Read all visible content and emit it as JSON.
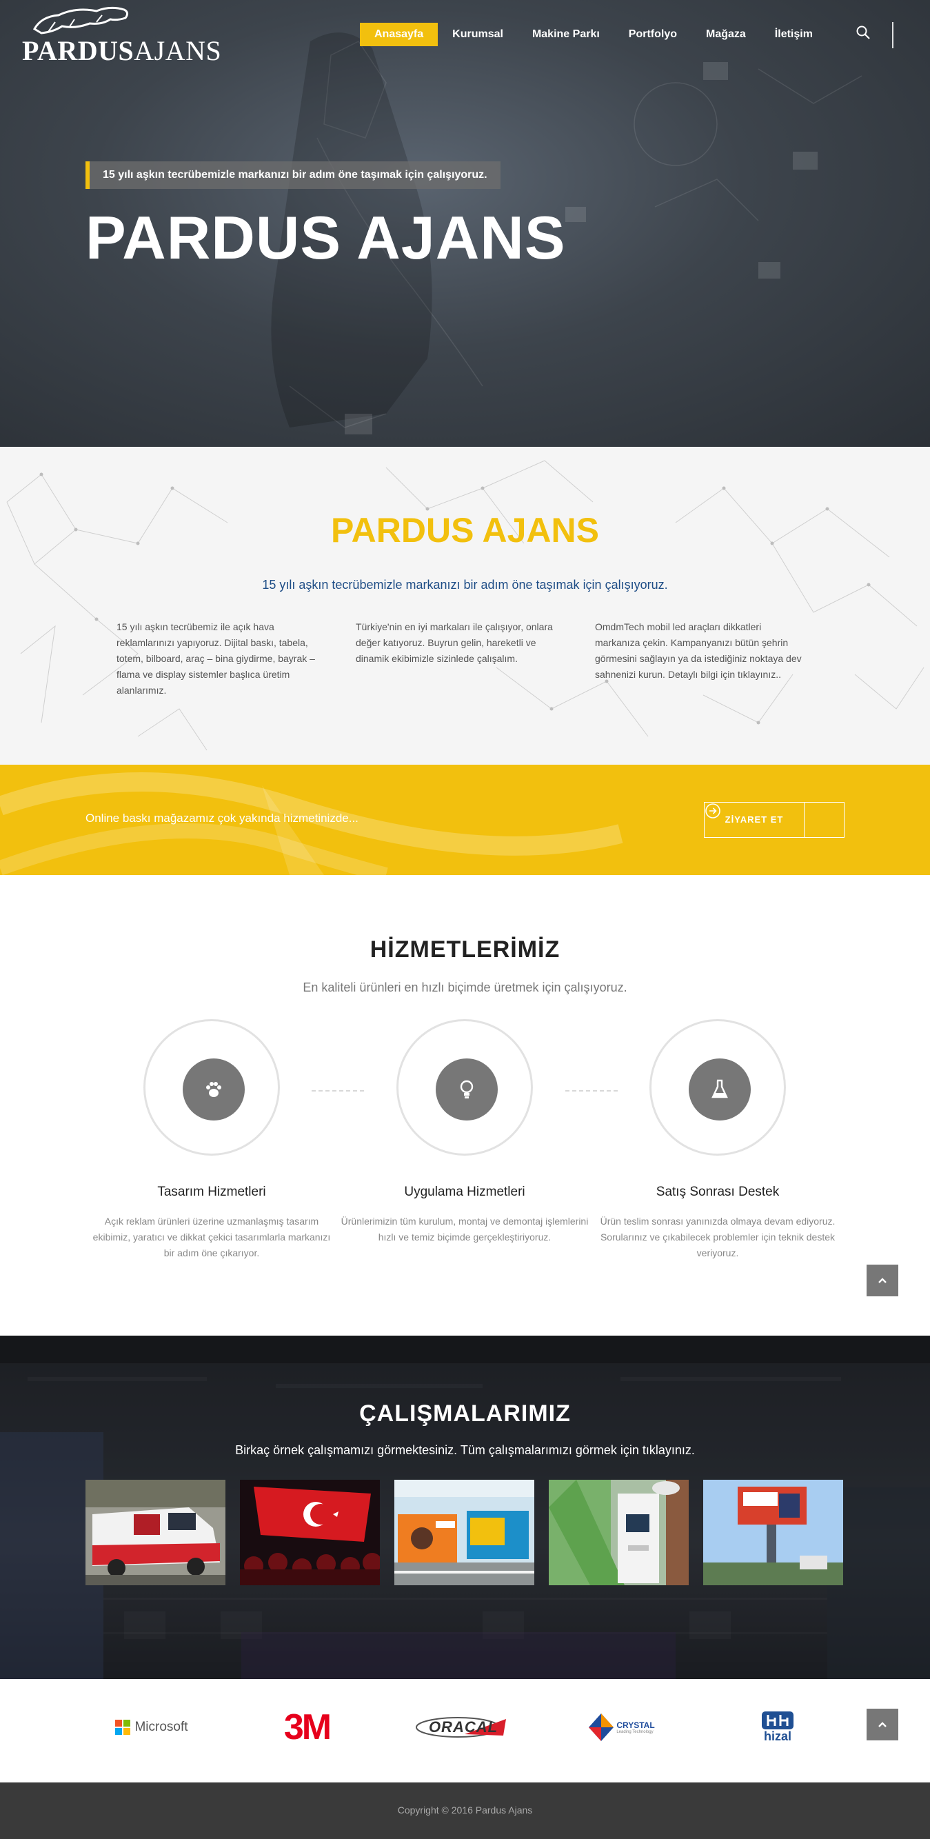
{
  "header": {
    "logo_text_bold": "PARDUS",
    "logo_text_light": "AJANS",
    "nav": [
      {
        "label": "Anasayfa",
        "active": true
      },
      {
        "label": "Kurumsal",
        "active": false
      },
      {
        "label": "Makine Parkı",
        "active": false
      },
      {
        "label": "Portfolyo",
        "active": false
      },
      {
        "label": "Mağaza",
        "active": false
      },
      {
        "label": "İletişim",
        "active": false
      }
    ],
    "search_icon": "search-icon"
  },
  "hero": {
    "tagline": "15 yılı aşkın tecrübemizle markanızı bir adım öne taşımak için çalışıyoruz.",
    "title": "PARDUS AJANS"
  },
  "about": {
    "title": "PARDUS AJANS",
    "subtitle": "15 yılı aşkın tecrübemizle markanızı bir adım öne taşımak için çalışıyoruz.",
    "columns": [
      "15 yılı aşkın tecrübemiz ile açık hava reklamlarınızı yapıyoruz. Dijital baskı, tabela, totem, bilboard, araç – bina giydirme, bayrak – flama ve display sistemler başlıca üretim alanlarımız.",
      "Türkiye'nin en iyi markaları ile çalışıyor, onlara değer katıyoruz. Buyrun gelin, hareketli ve dinamik ekibimizle sizinlede çalışalım.",
      "OmdmTech mobil led araçları dikkatleri markanıza çekin. Kampanyanızı bütün şehrin görmesini sağlayın ya da istediğiniz noktaya dev sahnenizi kurun. Detaylı bilgi için tıklayınız.."
    ]
  },
  "promo": {
    "text": "Online baskı mağazamız çok yakında hizmetinizde...",
    "button_label": "ZİYARET ET"
  },
  "services": {
    "title": "HİZMETLERİMİZ",
    "subtitle": "En kaliteli ürünleri en hızlı biçimde üretmek için çalışıyoruz.",
    "items": [
      {
        "title": "Tasarım Hizmetleri",
        "text": "Açık reklam ürünleri üzerine uzmanlaşmış tasarım ekibimiz, yaratıcı ve dikkat çekici tasarımlarla markanızı bir adım öne çıkarıyor.",
        "icon": "paw-icon"
      },
      {
        "title": "Uygulama Hizmetleri",
        "text": "Ürünlerimizin tüm kurulum, montaj ve demontaj işlemlerini hızlı ve temiz biçimde gerçekleştiriyoruz.",
        "icon": "lightbulb-icon"
      },
      {
        "title": "Satış Sonrası Destek",
        "text": "Ürün teslim sonrası yanınızda olmaya devam ediyoruz. Sorularınız ve çıkabilecek problemler için teknik destek veriyoruz.",
        "icon": "flask-icon"
      }
    ]
  },
  "works": {
    "title": "ÇALIŞMALARIMIZ",
    "subtitle": "Birkaç örnek çalışmamızı görmektesiniz. Tüm çalışmalarımızı görmek için tıklayınız.",
    "thumbs": [
      "van-wrap-photo",
      "flag-crowd-photo",
      "billboard-street-photo",
      "atm-kiosk-photo",
      "billboard-tower-photo"
    ]
  },
  "brands": {
    "microsoft": "Microsoft",
    "threem": "3M",
    "oracal": "ORACAL",
    "crystal": "CRYSTAL",
    "crystal_tag": "Leading Technology",
    "hizal": "hizal"
  },
  "footer": {
    "copyright": "Copyright © 2016 Pardus Ajans"
  },
  "colors": {
    "accent": "#f2c00e",
    "subtitle_blue": "#1e4d86",
    "footer_bg": "#3a3a3a"
  }
}
